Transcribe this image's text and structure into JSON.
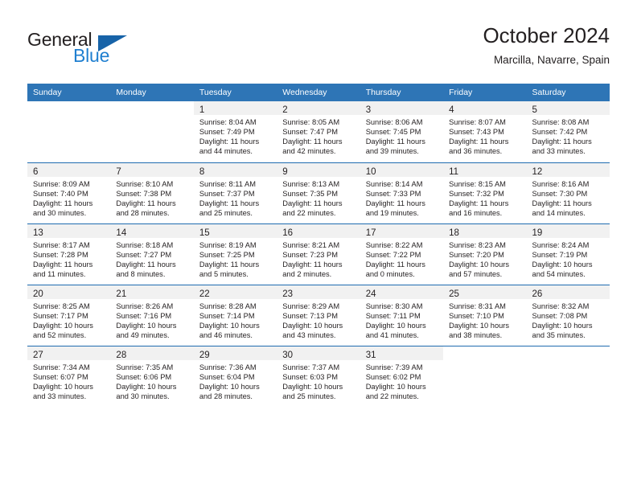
{
  "brand": {
    "word1": "General",
    "word2": "Blue",
    "triangle_color": "#1763a8"
  },
  "header": {
    "title": "October 2024",
    "subtitle": "Marcilla, Navarre, Spain"
  },
  "colors": {
    "header_blue": "#2e75b6",
    "row_rule_blue": "#1f6cb0",
    "daynum_band": "#f1f1f1",
    "text": "#231f20"
  },
  "weekdays": [
    "Sunday",
    "Monday",
    "Tuesday",
    "Wednesday",
    "Thursday",
    "Friday",
    "Saturday"
  ],
  "weeks": [
    [
      {
        "day": "",
        "sunrise": "",
        "sunset": "",
        "daylight1": "",
        "daylight2": "",
        "blank": true
      },
      {
        "day": "",
        "sunrise": "",
        "sunset": "",
        "daylight1": "",
        "daylight2": "",
        "blank": true
      },
      {
        "day": "1",
        "sunrise": "Sunrise: 8:04 AM",
        "sunset": "Sunset: 7:49 PM",
        "daylight1": "Daylight: 11 hours",
        "daylight2": "and 44 minutes."
      },
      {
        "day": "2",
        "sunrise": "Sunrise: 8:05 AM",
        "sunset": "Sunset: 7:47 PM",
        "daylight1": "Daylight: 11 hours",
        "daylight2": "and 42 minutes."
      },
      {
        "day": "3",
        "sunrise": "Sunrise: 8:06 AM",
        "sunset": "Sunset: 7:45 PM",
        "daylight1": "Daylight: 11 hours",
        "daylight2": "and 39 minutes."
      },
      {
        "day": "4",
        "sunrise": "Sunrise: 8:07 AM",
        "sunset": "Sunset: 7:43 PM",
        "daylight1": "Daylight: 11 hours",
        "daylight2": "and 36 minutes."
      },
      {
        "day": "5",
        "sunrise": "Sunrise: 8:08 AM",
        "sunset": "Sunset: 7:42 PM",
        "daylight1": "Daylight: 11 hours",
        "daylight2": "and 33 minutes."
      }
    ],
    [
      {
        "day": "6",
        "sunrise": "Sunrise: 8:09 AM",
        "sunset": "Sunset: 7:40 PM",
        "daylight1": "Daylight: 11 hours",
        "daylight2": "and 30 minutes."
      },
      {
        "day": "7",
        "sunrise": "Sunrise: 8:10 AM",
        "sunset": "Sunset: 7:38 PM",
        "daylight1": "Daylight: 11 hours",
        "daylight2": "and 28 minutes."
      },
      {
        "day": "8",
        "sunrise": "Sunrise: 8:11 AM",
        "sunset": "Sunset: 7:37 PM",
        "daylight1": "Daylight: 11 hours",
        "daylight2": "and 25 minutes."
      },
      {
        "day": "9",
        "sunrise": "Sunrise: 8:13 AM",
        "sunset": "Sunset: 7:35 PM",
        "daylight1": "Daylight: 11 hours",
        "daylight2": "and 22 minutes."
      },
      {
        "day": "10",
        "sunrise": "Sunrise: 8:14 AM",
        "sunset": "Sunset: 7:33 PM",
        "daylight1": "Daylight: 11 hours",
        "daylight2": "and 19 minutes."
      },
      {
        "day": "11",
        "sunrise": "Sunrise: 8:15 AM",
        "sunset": "Sunset: 7:32 PM",
        "daylight1": "Daylight: 11 hours",
        "daylight2": "and 16 minutes."
      },
      {
        "day": "12",
        "sunrise": "Sunrise: 8:16 AM",
        "sunset": "Sunset: 7:30 PM",
        "daylight1": "Daylight: 11 hours",
        "daylight2": "and 14 minutes."
      }
    ],
    [
      {
        "day": "13",
        "sunrise": "Sunrise: 8:17 AM",
        "sunset": "Sunset: 7:28 PM",
        "daylight1": "Daylight: 11 hours",
        "daylight2": "and 11 minutes."
      },
      {
        "day": "14",
        "sunrise": "Sunrise: 8:18 AM",
        "sunset": "Sunset: 7:27 PM",
        "daylight1": "Daylight: 11 hours",
        "daylight2": "and 8 minutes."
      },
      {
        "day": "15",
        "sunrise": "Sunrise: 8:19 AM",
        "sunset": "Sunset: 7:25 PM",
        "daylight1": "Daylight: 11 hours",
        "daylight2": "and 5 minutes."
      },
      {
        "day": "16",
        "sunrise": "Sunrise: 8:21 AM",
        "sunset": "Sunset: 7:23 PM",
        "daylight1": "Daylight: 11 hours",
        "daylight2": "and 2 minutes."
      },
      {
        "day": "17",
        "sunrise": "Sunrise: 8:22 AM",
        "sunset": "Sunset: 7:22 PM",
        "daylight1": "Daylight: 11 hours",
        "daylight2": "and 0 minutes."
      },
      {
        "day": "18",
        "sunrise": "Sunrise: 8:23 AM",
        "sunset": "Sunset: 7:20 PM",
        "daylight1": "Daylight: 10 hours",
        "daylight2": "and 57 minutes."
      },
      {
        "day": "19",
        "sunrise": "Sunrise: 8:24 AM",
        "sunset": "Sunset: 7:19 PM",
        "daylight1": "Daylight: 10 hours",
        "daylight2": "and 54 minutes."
      }
    ],
    [
      {
        "day": "20",
        "sunrise": "Sunrise: 8:25 AM",
        "sunset": "Sunset: 7:17 PM",
        "daylight1": "Daylight: 10 hours",
        "daylight2": "and 52 minutes."
      },
      {
        "day": "21",
        "sunrise": "Sunrise: 8:26 AM",
        "sunset": "Sunset: 7:16 PM",
        "daylight1": "Daylight: 10 hours",
        "daylight2": "and 49 minutes."
      },
      {
        "day": "22",
        "sunrise": "Sunrise: 8:28 AM",
        "sunset": "Sunset: 7:14 PM",
        "daylight1": "Daylight: 10 hours",
        "daylight2": "and 46 minutes."
      },
      {
        "day": "23",
        "sunrise": "Sunrise: 8:29 AM",
        "sunset": "Sunset: 7:13 PM",
        "daylight1": "Daylight: 10 hours",
        "daylight2": "and 43 minutes."
      },
      {
        "day": "24",
        "sunrise": "Sunrise: 8:30 AM",
        "sunset": "Sunset: 7:11 PM",
        "daylight1": "Daylight: 10 hours",
        "daylight2": "and 41 minutes."
      },
      {
        "day": "25",
        "sunrise": "Sunrise: 8:31 AM",
        "sunset": "Sunset: 7:10 PM",
        "daylight1": "Daylight: 10 hours",
        "daylight2": "and 38 minutes."
      },
      {
        "day": "26",
        "sunrise": "Sunrise: 8:32 AM",
        "sunset": "Sunset: 7:08 PM",
        "daylight1": "Daylight: 10 hours",
        "daylight2": "and 35 minutes."
      }
    ],
    [
      {
        "day": "27",
        "sunrise": "Sunrise: 7:34 AM",
        "sunset": "Sunset: 6:07 PM",
        "daylight1": "Daylight: 10 hours",
        "daylight2": "and 33 minutes."
      },
      {
        "day": "28",
        "sunrise": "Sunrise: 7:35 AM",
        "sunset": "Sunset: 6:06 PM",
        "daylight1": "Daylight: 10 hours",
        "daylight2": "and 30 minutes."
      },
      {
        "day": "29",
        "sunrise": "Sunrise: 7:36 AM",
        "sunset": "Sunset: 6:04 PM",
        "daylight1": "Daylight: 10 hours",
        "daylight2": "and 28 minutes."
      },
      {
        "day": "30",
        "sunrise": "Sunrise: 7:37 AM",
        "sunset": "Sunset: 6:03 PM",
        "daylight1": "Daylight: 10 hours",
        "daylight2": "and 25 minutes."
      },
      {
        "day": "31",
        "sunrise": "Sunrise: 7:39 AM",
        "sunset": "Sunset: 6:02 PM",
        "daylight1": "Daylight: 10 hours",
        "daylight2": "and 22 minutes."
      },
      {
        "day": "",
        "sunrise": "",
        "sunset": "",
        "daylight1": "",
        "daylight2": "",
        "blank": true
      },
      {
        "day": "",
        "sunrise": "",
        "sunset": "",
        "daylight1": "",
        "daylight2": "",
        "blank": true
      }
    ]
  ]
}
